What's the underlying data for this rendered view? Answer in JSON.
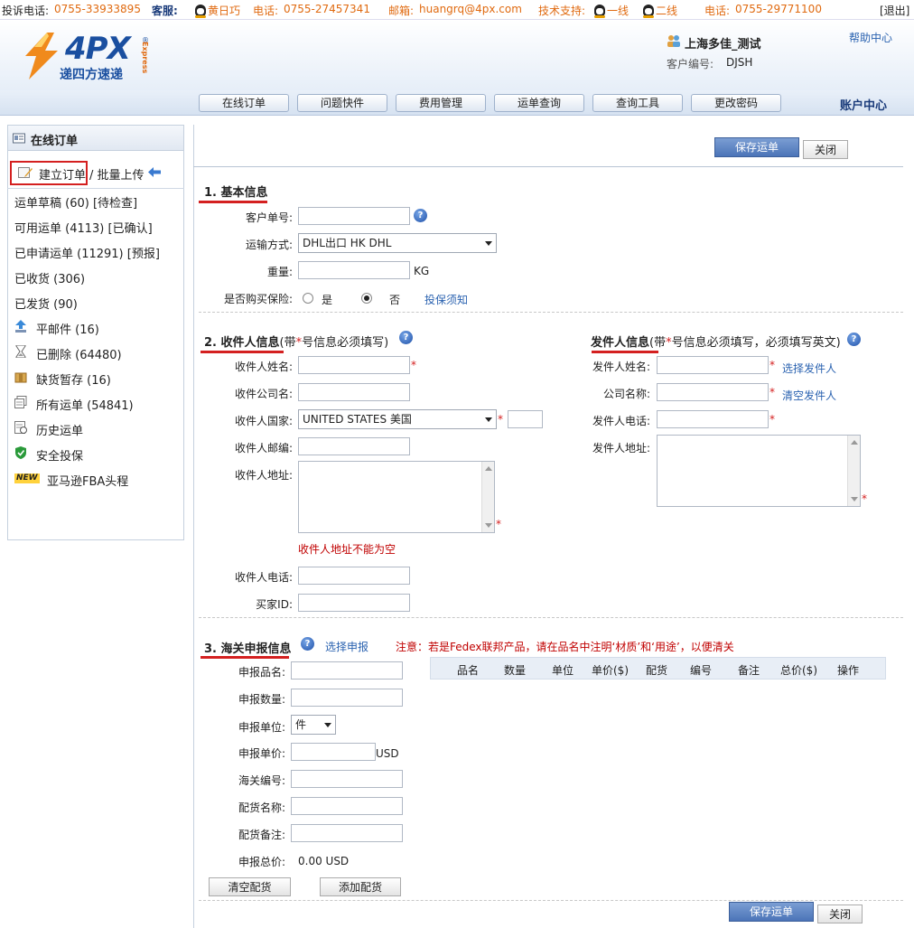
{
  "topbar": {
    "complaint_label": "投诉电话:",
    "complaint_phone": "0755-33933895",
    "service_label": "客服:",
    "service_name": "黄日巧",
    "phone_label": "电话:",
    "service_phone": "0755-27457341",
    "email_label": "邮箱:",
    "email": "huangrq@4px.com",
    "tech_label": "技术支持:",
    "tech_line1": "一线",
    "tech_line2": "二线",
    "phone2_label": "电话:",
    "tech_phone": "0755-29771100",
    "logout": "[退出]"
  },
  "header": {
    "logo_text": "4PX",
    "logo_reg": "®",
    "logo_sub": "递四方速递",
    "logo_express": "Express",
    "company": "上海多佳_测试",
    "customer_code_label": "客户编号:",
    "customer_code": "DJSH",
    "help": "帮助中心"
  },
  "nav": {
    "items": [
      "在线订单",
      "问题快件",
      "费用管理",
      "运单查询",
      "查询工具",
      "更改密码"
    ],
    "account_center": "账户中心"
  },
  "sidebar": {
    "title": "在线订单",
    "create_order": "建立订单",
    "batch_upload": "/ 批量上传",
    "items": [
      "运单草稿 (60) [待检查]",
      "可用运单 (4113) [已确认]",
      "已申请运单 (11291) [预报]",
      "已收货 (306)",
      "已发货 (90)",
      "平邮件 (16)",
      "已删除 (64480)",
      "缺货暂存 (16)",
      "所有运单 (54841)",
      "历史运单",
      "安全投保",
      "亚马逊FBA头程"
    ],
    "new_badge": "NEW"
  },
  "toolbar": {
    "save": "保存运单",
    "close": "关闭"
  },
  "basic": {
    "title": "1. 基本信息",
    "customer_no_label": "客户单号:",
    "customer_no": "",
    "shipping_label": "运输方式:",
    "shipping_value": "DHL出口  HK DHL",
    "weight_label": "重量:",
    "weight": "",
    "weight_unit": "KG",
    "insurance_label": "是否购买保险:",
    "insurance_yes": "是",
    "insurance_no": "否",
    "insurance_notice": "投保须知"
  },
  "recipient": {
    "title": "2. 收件人信息",
    "note_pre": "(带",
    "note_star": "*",
    "note_post": "号信息必须填写)",
    "name_label": "收件人姓名:",
    "company_label": "收件公司名:",
    "country_label": "收件人国家:",
    "country_value": "UNITED STATES 美国",
    "zip_label": "收件人邮编:",
    "address_label": "收件人地址:",
    "address_error": "收件人地址不能为空",
    "phone_label": "收件人电话:",
    "buyer_label": "买家ID:"
  },
  "sender": {
    "title": "发件人信息",
    "note_pre": "(带",
    "note_star": "*",
    "note_post": "号信息必须填写，必须填写英文)",
    "name_label": "发件人姓名:",
    "select_sender": "选择发件人",
    "company_label": "公司名称:",
    "clear_sender": "清空发件人",
    "phone_label": "发件人电话:",
    "address_label": "发件人地址:"
  },
  "customs": {
    "title": "3. 海关申报信息",
    "select_declare": "选择申报",
    "notice": "注意：若是Fedex联邦产品，请在品名中注明‘材质’和‘用途’，以便清关",
    "name_label": "申报品名:",
    "qty_label": "申报数量:",
    "unit_label": "申报单位:",
    "unit_value": "件",
    "price_label": "申报单价:",
    "price_unit": "USD",
    "hs_label": "海关编号:",
    "cargo_name_label": "配货名称:",
    "cargo_remark_label": "配货备注:",
    "total_label": "申报总价:",
    "total_value": "0.00 USD",
    "table_headers": [
      "品名",
      "数量",
      "单位",
      "单价($)",
      "配货",
      "编号",
      "备注",
      "总价($)",
      "操作"
    ],
    "clear_cargo": "清空配货",
    "add_cargo": "添加配货"
  },
  "required_mark": "*"
}
